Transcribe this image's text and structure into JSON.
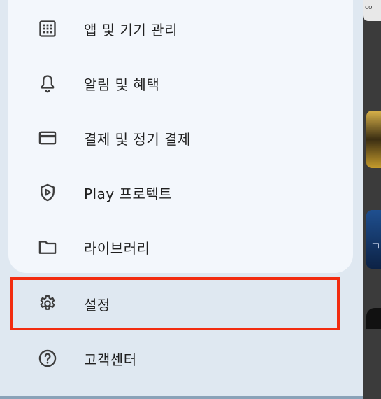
{
  "menu": {
    "items": [
      {
        "label": "앱 및 기기 관리",
        "icon": "apps-grid-icon"
      },
      {
        "label": "알림 및 혜택",
        "icon": "bell-icon"
      },
      {
        "label": "결제 및 정기 결제",
        "icon": "credit-card-icon"
      },
      {
        "label": "Play 프로텍트",
        "icon": "play-protect-shield-icon"
      },
      {
        "label": "라이브러리",
        "icon": "folder-icon"
      }
    ]
  },
  "outer": {
    "settings_label": "설정",
    "help_label": "고객센터"
  },
  "right_strip": {
    "top_text": "co"
  },
  "colors": {
    "panel_bg": "#f3f7fc",
    "page_bg": "#dfe8f1",
    "highlight": "#f22c10"
  }
}
